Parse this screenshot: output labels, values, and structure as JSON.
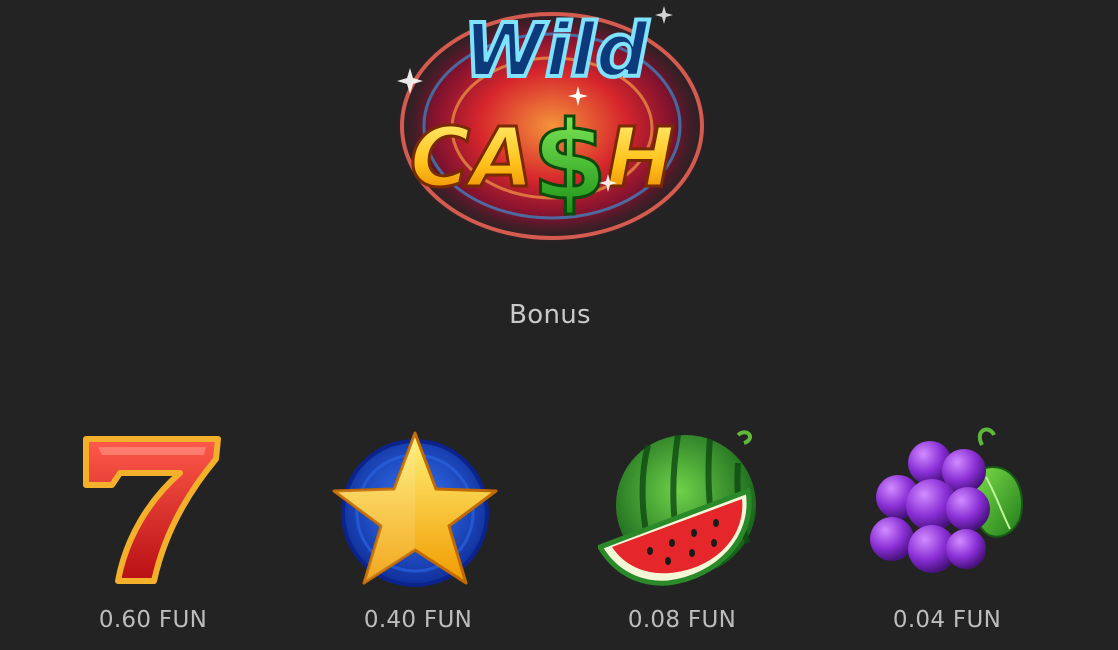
{
  "logo": {
    "line1": "Wild",
    "line2_left": "CA",
    "line2_dollar": "$",
    "line2_right": "H",
    "colors": {
      "neon_blue": "#4fd0ff",
      "gold": "#ffc21a",
      "green": "#2dbb1e",
      "ring_red": "#d9182a"
    }
  },
  "section": {
    "label": "Bonus"
  },
  "symbols": [
    {
      "icon": "seven-icon",
      "payout": "0.60 FUN",
      "color": "#e11a1a"
    },
    {
      "icon": "star-icon",
      "payout": "0.40 FUN",
      "color": "#ffc400"
    },
    {
      "icon": "watermelon-icon",
      "payout": "0.08 FUN",
      "color": "#e5262a"
    },
    {
      "icon": "grapes-icon",
      "payout": "0.04 FUN",
      "color": "#8a2fd6"
    }
  ]
}
